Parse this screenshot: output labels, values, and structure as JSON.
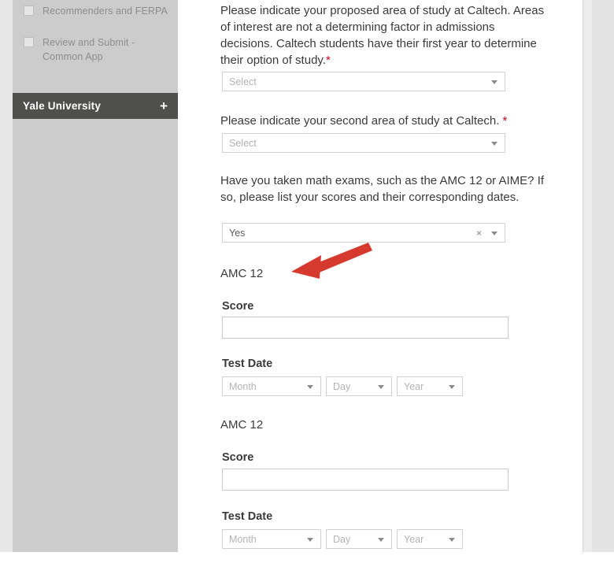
{
  "sidebar": {
    "items": [
      {
        "label": "Recommenders and FERPA",
        "checkbox": "unchecked-checkbox"
      },
      {
        "label": "Review and Submit - Common App",
        "checkbox": "unchecked-checkbox"
      }
    ],
    "school_bar": {
      "title": "Yale University",
      "expand_label": "+"
    }
  },
  "form": {
    "questions": [
      {
        "id": "proposed-area-of-study",
        "text": "Please indicate your proposed area of study at Caltech. Areas of interest are not a determining factor in admissions decisions. Caltech students have their first year to determine their option of study.",
        "required_marker": "*",
        "select_value": "",
        "select_placeholder": "Select"
      },
      {
        "id": "second-area-of-study",
        "text": "Please indicate your second area of study at Caltech.",
        "required_marker": "*",
        "select_value": "",
        "select_placeholder": "Select"
      },
      {
        "id": "math-exams",
        "text": "Have you taken math exams, such as the AMC 12 or AIME? If so, please list your scores and their corresponding dates.",
        "required_marker": "",
        "select_value": "Yes",
        "select_placeholder": "Select",
        "clear_icon": "×"
      }
    ],
    "exam_entries": [
      {
        "exam_name": "AMC 12",
        "score_label": "Score",
        "score_value": "",
        "test_date_label": "Test Date",
        "month_placeholder": "Month",
        "day_placeholder": "Day",
        "year_placeholder": "Year"
      },
      {
        "exam_name": "AMC 12",
        "score_label": "Score",
        "score_value": "",
        "test_date_label": "Test Date",
        "month_placeholder": "Month",
        "day_placeholder": "Day",
        "year_placeholder": "Year"
      }
    ]
  },
  "annotation": {
    "arrow_color": "#d63a2e",
    "points_to": "AMC 12"
  }
}
